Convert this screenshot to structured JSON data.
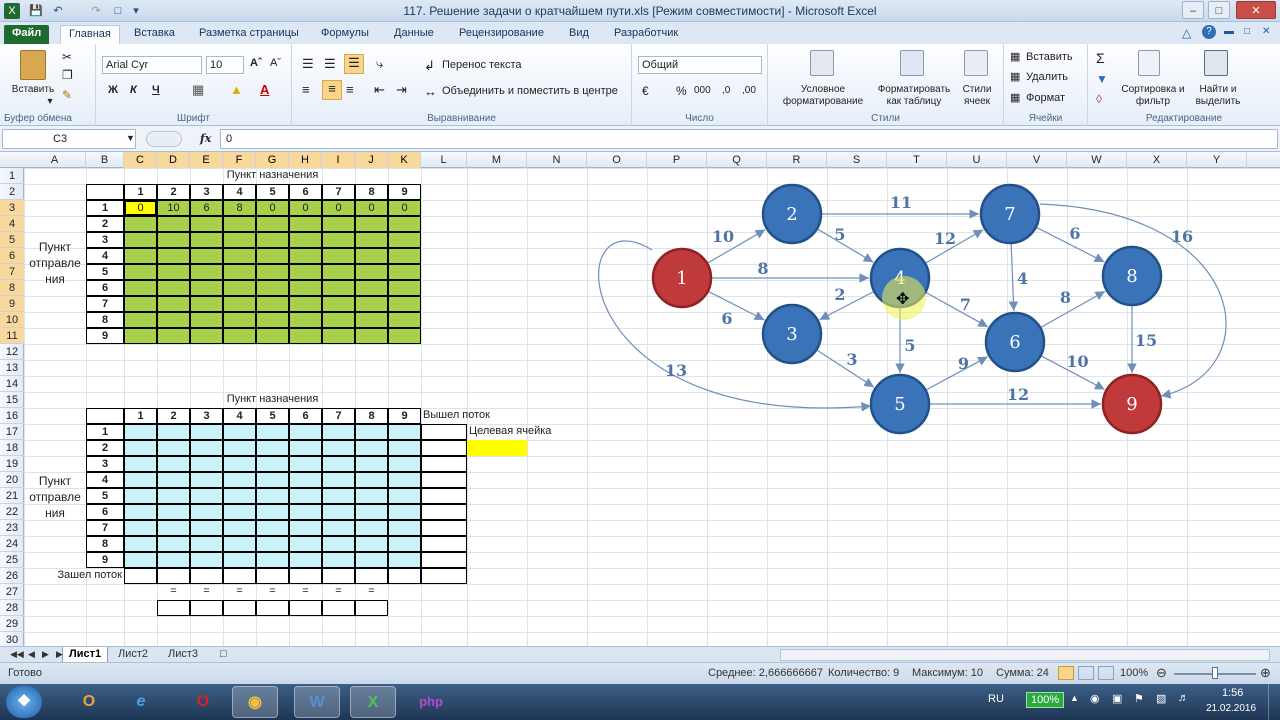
{
  "window": {
    "title": "117. Решение задачи о кратчайшем пути.xls  [Режим совместимости]  -  Microsoft Excel"
  },
  "ribbon_tabs": [
    "Файл",
    "Главная",
    "Вставка",
    "Разметка страницы",
    "Формулы",
    "Данные",
    "Рецензирование",
    "Вид",
    "Разработчик"
  ],
  "ribbon": {
    "clipboard": {
      "paste": "Вставить",
      "group": "Буфер обмена"
    },
    "font": {
      "name": "Arial Cyr",
      "size": "10",
      "bold": "Ж",
      "italic": "К",
      "underline": "Ч",
      "group": "Шрифт"
    },
    "align": {
      "wrap": "Перенос текста",
      "merge": "Объединить и поместить в центре",
      "group": "Выравнивание"
    },
    "number": {
      "format": "Общий",
      "group": "Число"
    },
    "styles": {
      "cond": "Условное форматирование",
      "table": "Форматировать как таблицу",
      "cell": "Стили ячеек",
      "group": "Стили"
    },
    "cells": {
      "insert": "Вставить",
      "delete": "Удалить",
      "format": "Формат",
      "group": "Ячейки"
    },
    "editing": {
      "sort": "Сортировка и фильтр",
      "find": "Найти и выделить",
      "group": "Редактирование"
    }
  },
  "formula_bar": {
    "name_box": "C3",
    "fx": "fx",
    "value": "0"
  },
  "columns": [
    "A",
    "B",
    "C",
    "D",
    "E",
    "F",
    "G",
    "H",
    "I",
    "J",
    "K",
    "L",
    "M",
    "N",
    "O",
    "P",
    "Q",
    "R",
    "S",
    "T",
    "U",
    "V",
    "W",
    "X",
    "Y"
  ],
  "rows": [
    "1",
    "2",
    "3",
    "4",
    "5",
    "6",
    "7",
    "8",
    "9",
    "10",
    "11",
    "12",
    "13",
    "14",
    "15",
    "16",
    "17",
    "18",
    "19",
    "20",
    "21",
    "22",
    "23",
    "24",
    "25",
    "26",
    "27",
    "28",
    "29",
    "30"
  ],
  "sheet": {
    "dest_title": "Пункт назначения",
    "src_label": [
      "Пункт",
      "отправле",
      "ния"
    ],
    "indices": [
      "1",
      "2",
      "3",
      "4",
      "5",
      "6",
      "7",
      "8",
      "9"
    ],
    "row3_values": [
      "0",
      "10",
      "6",
      "8",
      "0",
      "0",
      "0",
      "0",
      "0"
    ],
    "dest_title2": "Пункт назначения",
    "out_flow": "Вышел поток",
    "target_cell": "Целевая ячейка",
    "in_flow": "Зашел поток",
    "eq": "="
  },
  "graph": {
    "nodes": [
      {
        "id": "1",
        "color": "red"
      },
      {
        "id": "2",
        "color": "blue"
      },
      {
        "id": "3",
        "color": "blue"
      },
      {
        "id": "4",
        "color": "blue"
      },
      {
        "id": "5",
        "color": "blue"
      },
      {
        "id": "6",
        "color": "blue"
      },
      {
        "id": "7",
        "color": "blue"
      },
      {
        "id": "8",
        "color": "blue"
      },
      {
        "id": "9",
        "color": "red"
      }
    ],
    "edges": [
      {
        "from": "1",
        "to": "2",
        "w": "10"
      },
      {
        "from": "1",
        "to": "4",
        "w": "8"
      },
      {
        "from": "1",
        "to": "3",
        "w": "6"
      },
      {
        "from": "1",
        "to": "5",
        "w": "13"
      },
      {
        "from": "2",
        "to": "7",
        "w": "11"
      },
      {
        "from": "2",
        "to": "4",
        "w": "5"
      },
      {
        "from": "4",
        "to": "3",
        "w": "2"
      },
      {
        "from": "4",
        "to": "7",
        "w": "12"
      },
      {
        "from": "4",
        "to": "6",
        "w": "7"
      },
      {
        "from": "4",
        "to": "5",
        "w": "5"
      },
      {
        "from": "3",
        "to": "5",
        "w": "3"
      },
      {
        "from": "7",
        "to": "6",
        "w": "4"
      },
      {
        "from": "7",
        "to": "8",
        "w": "6"
      },
      {
        "from": "7",
        "to": "9",
        "w": "16"
      },
      {
        "from": "5",
        "to": "6",
        "w": "9"
      },
      {
        "from": "5",
        "to": "9",
        "w": "12"
      },
      {
        "from": "6",
        "to": "8",
        "w": "8"
      },
      {
        "from": "6",
        "to": "9",
        "w": "10"
      },
      {
        "from": "8",
        "to": "9",
        "w": "15"
      }
    ],
    "colors": {
      "red": "#c0393b",
      "blue": "#3a73b8",
      "edge": "#6d8fb8",
      "label": "#4f75a5"
    }
  },
  "sheet_tabs": [
    "Лист1",
    "Лист2",
    "Лист3"
  ],
  "status": {
    "ready": "Готово",
    "average": "Среднее: 2,666666667",
    "count": "Количество: 9",
    "max": "Максимум: 10",
    "sum": "Сумма: 24",
    "zoom": "100%"
  },
  "taskbar": {
    "lang": "RU",
    "battery": "100%",
    "time": "1:56",
    "date": "21.02.2016"
  }
}
